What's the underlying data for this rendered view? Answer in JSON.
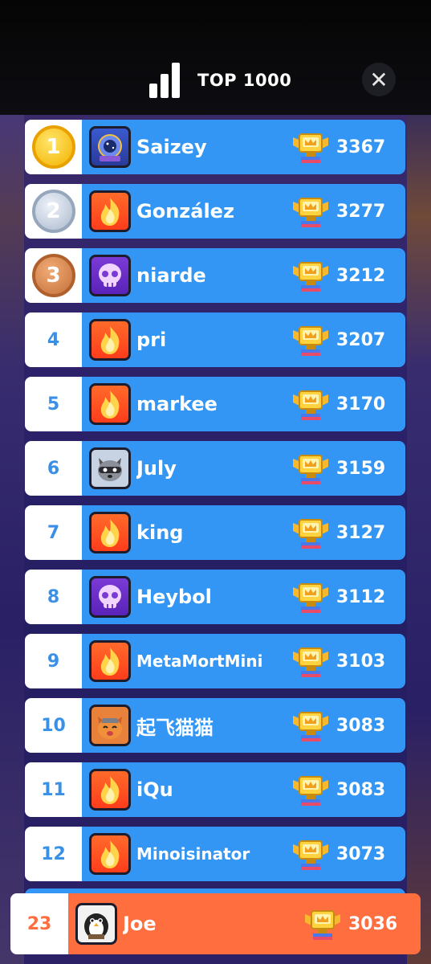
{
  "header": {
    "title": "TOP 1000",
    "close_label": "✕"
  },
  "rows": [
    {
      "rank": "1",
      "medal": "gold",
      "avatar": "wizard-avatar",
      "name": "Saizey",
      "score": "3367"
    },
    {
      "rank": "2",
      "medal": "silver",
      "avatar": "fire-avatar",
      "name": "González",
      "score": "3277"
    },
    {
      "rank": "3",
      "medal": "bronze",
      "avatar": "skull-avatar",
      "name": "niarde",
      "score": "3212"
    },
    {
      "rank": "4",
      "avatar": "fire-avatar",
      "name": "pri",
      "score": "3207"
    },
    {
      "rank": "5",
      "avatar": "fire-avatar",
      "name": "markee",
      "score": "3170"
    },
    {
      "rank": "6",
      "avatar": "raccoon-avatar",
      "name": "July",
      "score": "3159"
    },
    {
      "rank": "7",
      "avatar": "fire-avatar",
      "name": "king",
      "score": "3127"
    },
    {
      "rank": "8",
      "avatar": "skull-avatar",
      "name": "Heybol",
      "score": "3112"
    },
    {
      "rank": "9",
      "avatar": "fire-avatar",
      "name": "MetaMortMini",
      "score": "3103"
    },
    {
      "rank": "10",
      "avatar": "cat-avatar",
      "name": "起飞猫猫",
      "score": "3083"
    },
    {
      "rank": "11",
      "avatar": "fire-avatar",
      "name": "iQu",
      "score": "3083"
    },
    {
      "rank": "12",
      "avatar": "fire-avatar",
      "name": "Minoisinator",
      "score": "3073"
    }
  ],
  "me": {
    "rank": "23",
    "avatar": "penguin-avatar",
    "name": "Joe",
    "score": "3036"
  },
  "colors": {
    "row_blue": "#3496f4",
    "me_orange": "#ff6e3f",
    "rank_text": "#3a8fe6"
  }
}
